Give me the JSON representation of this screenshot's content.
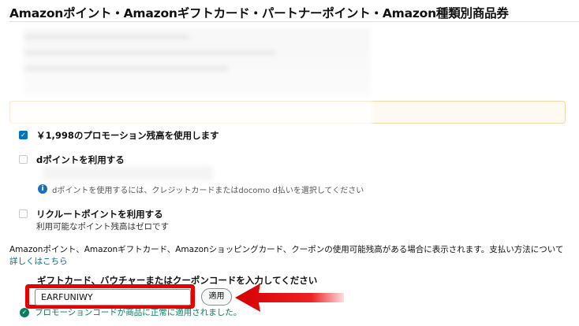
{
  "section": {
    "title": "Amazonポイント・Amazonギフトカード・パートナーポイント・Amazon種類別商品券"
  },
  "options": {
    "promo": {
      "label": "￥1,998のプロモーション残高を使用します",
      "checked": true
    },
    "dpoint": {
      "label": "dポイントを利用する",
      "info": "dポイントを使用するには、クレジットカードまたはdocomo d払いを選択してください",
      "checked": false
    },
    "recruit": {
      "label": "リクルートポイントを利用する",
      "sub": "利用可能なポイント残高はゼロです",
      "checked": false
    }
  },
  "notice": {
    "text": "Amazonポイント、Amazonギフトカード、Amazonショッピングカード、クーポンの使用可能残高がある場合に表示されます。支払い方法について",
    "link": "詳しくはこちら"
  },
  "giftcard": {
    "label": "ギフトカード、バウチャーまたはクーポンコードを入力してください",
    "value": "EARFUNIWY",
    "apply_label": "適用",
    "success": "プロモーションコードが商品に正常に適用されました。"
  },
  "colors": {
    "accent_red": "#e60000",
    "checkbox_blue": "#0073bb",
    "success_green": "#067d62",
    "link": "#007185"
  }
}
